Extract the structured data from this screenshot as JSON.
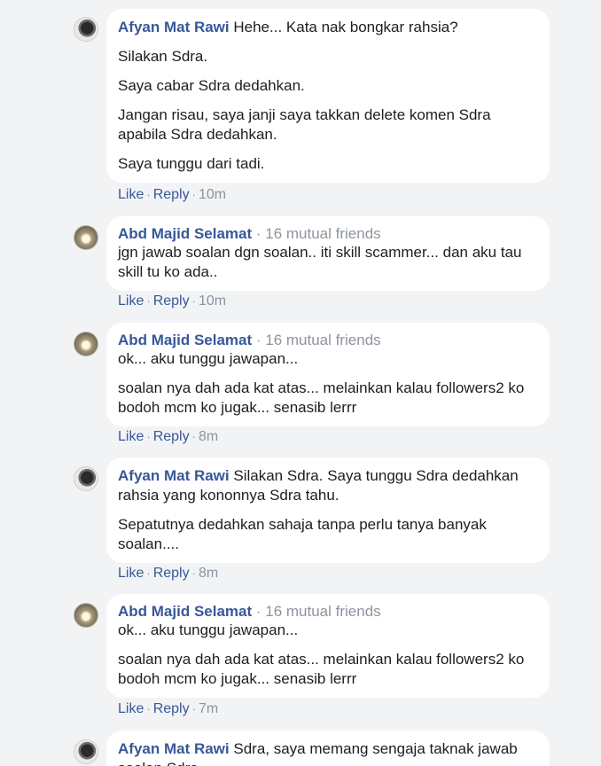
{
  "comments": [
    {
      "author": "Afyan Mat Rawi",
      "mutual": "",
      "paragraphs": [
        "Hehe... Kata nak bongkar rahsia?",
        "Silakan Sdra.",
        "Saya cabar Sdra dedahkan.",
        "Jangan risau, saya janji saya takkan delete komen Sdra apabila Sdra dedahkan.",
        "Saya tunggu dari tadi."
      ],
      "like": "Like",
      "reply": "Reply",
      "time": "10m"
    },
    {
      "author": "Abd Majid Selamat",
      "mutual": "16 mutual friends",
      "paragraphs": [
        "jgn jawab soalan dgn soalan.. iti skill scammer... dan aku tau skill tu ko ada.."
      ],
      "like": "Like",
      "reply": "Reply",
      "time": "10m"
    },
    {
      "author": "Abd Majid Selamat",
      "mutual": "16 mutual friends",
      "paragraphs": [
        "ok... aku tunggu jawapan...",
        "soalan nya dah ada kat atas... melainkan kalau followers2 ko bodoh mcm ko jugak... senasib lerrr"
      ],
      "like": "Like",
      "reply": "Reply",
      "time": "8m"
    },
    {
      "author": "Afyan Mat Rawi",
      "mutual": "",
      "paragraphs": [
        "Silakan Sdra. Saya tunggu Sdra dedahkan rahsia yang kononnya Sdra tahu.",
        "Sepatutnya dedahkan sahaja tanpa perlu tanya banyak soalan...."
      ],
      "like": "Like",
      "reply": "Reply",
      "time": "8m"
    },
    {
      "author": "Abd Majid Selamat",
      "mutual": "16 mutual friends",
      "paragraphs": [
        "ok... aku tunggu jawapan...",
        "soalan nya dah ada kat atas... melainkan kalau followers2 ko bodoh mcm ko jugak... senasib lerrr"
      ],
      "like": "Like",
      "reply": "Reply",
      "time": "7m"
    },
    {
      "author": "Afyan Mat Rawi",
      "mutual": "",
      "paragraphs": [
        "Sdra, saya memang sengaja taknak jawab soalan Sdra"
      ],
      "like": "",
      "reply": "",
      "time": ""
    }
  ],
  "separator": "·"
}
